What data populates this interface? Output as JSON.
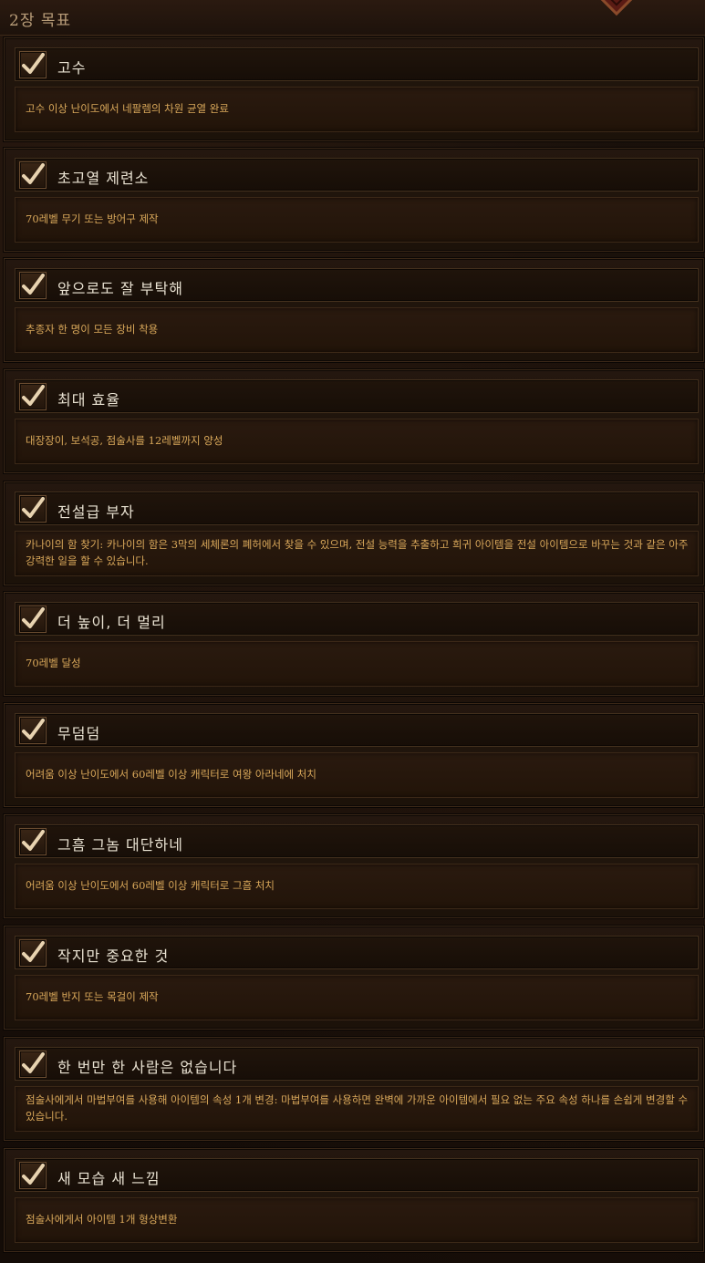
{
  "header": {
    "title": "2장 목표"
  },
  "achievements": [
    {
      "title": "고수",
      "description": "고수 이상 난이도에서 네팔렘의 차원 균열 완료",
      "completed": true
    },
    {
      "title": "초고열 제련소",
      "description": "70레벨 무기 또는 방어구 제작",
      "completed": true
    },
    {
      "title": "앞으로도 잘 부탁해",
      "description": "추종자 한 명이 모든 장비 착용",
      "completed": true
    },
    {
      "title": "최대 효율",
      "description": "대장장이, 보석공, 점술사를 12레벨까지 양성",
      "completed": true
    },
    {
      "title": "전설급 부자",
      "description": "카나이의 함 찾기: 카나이의 함은 3막의 세체론의 폐허에서 찾을 수 있으며, 전설 능력을 추출하고 희귀 아이템을 전설 아이템으로 바꾸는 것과 같은 아주 강력한 일을 할 수 있습니다.",
      "completed": true
    },
    {
      "title": "더 높이, 더 멀리",
      "description": "70레벨 달성",
      "completed": true
    },
    {
      "title": "무덤덤",
      "description": "어려움 이상 난이도에서 60레벨 이상 캐릭터로 여왕 아라네에 처치",
      "completed": true
    },
    {
      "title": "그흠 그놈 대단하네",
      "description": "어려움 이상 난이도에서 60레벨 이상 캐릭터로 그흠 처치",
      "completed": true
    },
    {
      "title": "작지만 중요한 것",
      "description": "70레벨 반지 또는 목걸이 제작",
      "completed": true
    },
    {
      "title": "한 번만 한 사람은 없습니다",
      "description": "점술사에게서 마법부여를 사용해 아이템의 속성 1개 변경: 마법부여를 사용하면 완벽에 가까운 아이템에서 필요 없는 주요 속성 하나를 손쉽게 변경할 수 있습니다.",
      "completed": true
    },
    {
      "title": "새 모습 새 느낌",
      "description": "점술사에게서 아이템 1개 형상변환",
      "completed": true
    }
  ],
  "colors": {
    "title_text": "#e9e2d2",
    "description_text": "#d9a85a",
    "header_text": "#b99d79",
    "checkmark": "#e8d3b0"
  },
  "icons": {
    "checkbox": "checkmark-icon",
    "emblem": "emblem-icon"
  }
}
